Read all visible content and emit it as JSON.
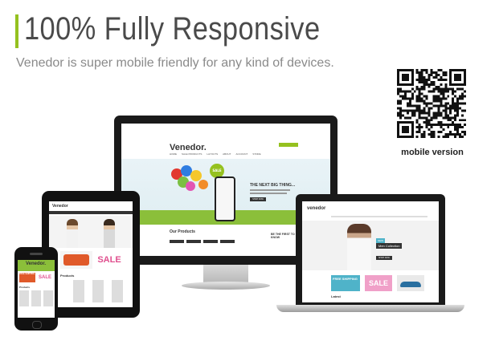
{
  "header": {
    "title": "100% Fully Responsive",
    "subtitle": "Venedor is super mobile friendly for any kind of devices."
  },
  "qr": {
    "label": "mobile version"
  },
  "desktop": {
    "brand": "Venedor.",
    "nav": [
      "HOME",
      "SALE PRODUCTS",
      "LAYOUTS",
      "ABOUT",
      "ACCOUNT",
      "STORE"
    ],
    "hero_badge": "SALE",
    "hero_title": "THE NEXT BIG THING...",
    "hero_button": "SHOP NOW",
    "section_title": "Our Products",
    "side_text": "BE THE FIRST TO KNOW"
  },
  "laptop": {
    "brand": "venedor",
    "hero_badge": "NEW",
    "hero_text": "Men Collection",
    "hero_button": "SHOP NOW",
    "free_text": "FREE SHIPPING",
    "sale_text": "SALE",
    "section_title": "Latest"
  },
  "tablet": {
    "brand": "Venedor",
    "free_text": "FREE SHIPPING",
    "sale_text": "SALE",
    "section_title": "Products"
  },
  "phone": {
    "brand": "Venedor.",
    "free_text": "FREE SHIPPING",
    "sale_text": "SALE",
    "section_title": "Products"
  },
  "colors": {
    "accent": "#95c11f",
    "title": "#4a4a4a",
    "subtitle": "#8a8a8a"
  }
}
